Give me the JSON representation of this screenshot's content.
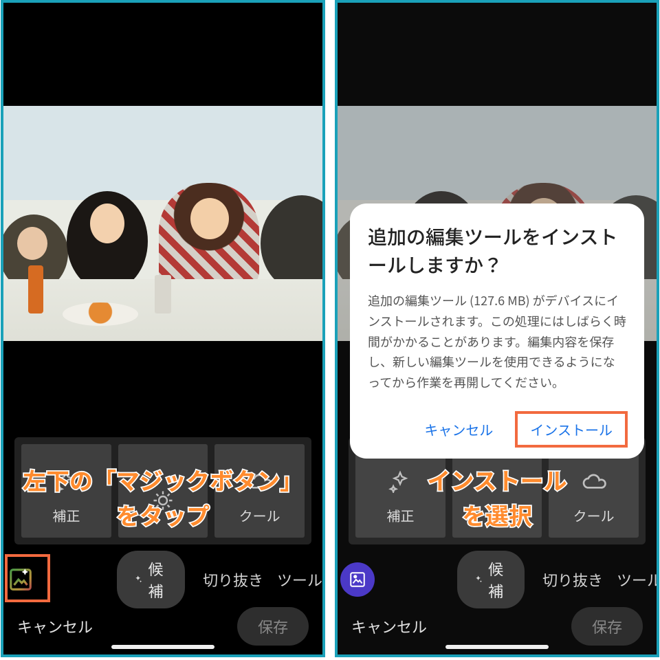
{
  "left": {
    "presets": {
      "a": "補正",
      "c": "クール"
    },
    "toolbar": {
      "suggest": "候補",
      "crop": "切り抜き",
      "tools": "ツール"
    },
    "footer": {
      "cancel": "キャンセル",
      "save": "保存"
    },
    "annotation_line1": "左下の「マジックボタン」",
    "annotation_line2": "をタップ"
  },
  "right": {
    "dialog": {
      "title": "追加の編集ツールをインストールしますか？",
      "body": "追加の編集ツール (127.6 MB) がデバイスにインストールされます。この処理にはしばらく時間がかかることがあります。編集内容を保存し、新しい編集ツールを使用できるようになってから作業を再開してください。",
      "cancel": "キャンセル",
      "install": "インストール"
    },
    "presets": {
      "a": "補正",
      "c": "クール"
    },
    "toolbar": {
      "suggest": "候補",
      "crop": "切り抜き",
      "tools": "ツール"
    },
    "footer": {
      "cancel": "キャンセル",
      "save": "保存"
    },
    "annotation_line1": "インストール",
    "annotation_line2": "を選択"
  }
}
